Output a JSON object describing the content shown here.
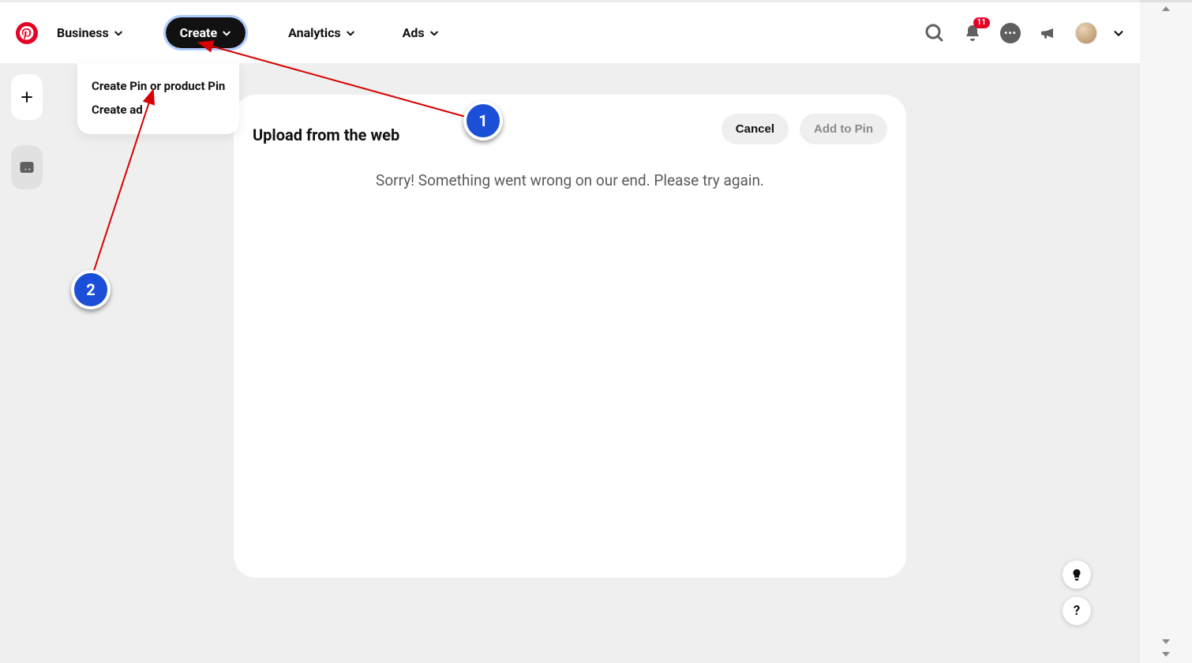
{
  "header": {
    "nav": {
      "business": "Business",
      "create": "Create",
      "analytics": "Analytics",
      "ads": "Ads"
    },
    "notifications_count": "11"
  },
  "dropdown": {
    "items": [
      "Create Pin or product Pin",
      "Create ad"
    ]
  },
  "panel": {
    "title": "Upload from the web",
    "cancel_label": "Cancel",
    "add_label": "Add to Pin",
    "error_message": "Sorry! Something went wrong on our end. Please try again."
  },
  "fab": {
    "help": "?"
  },
  "annotations": {
    "marker1": "1",
    "marker2": "2"
  }
}
